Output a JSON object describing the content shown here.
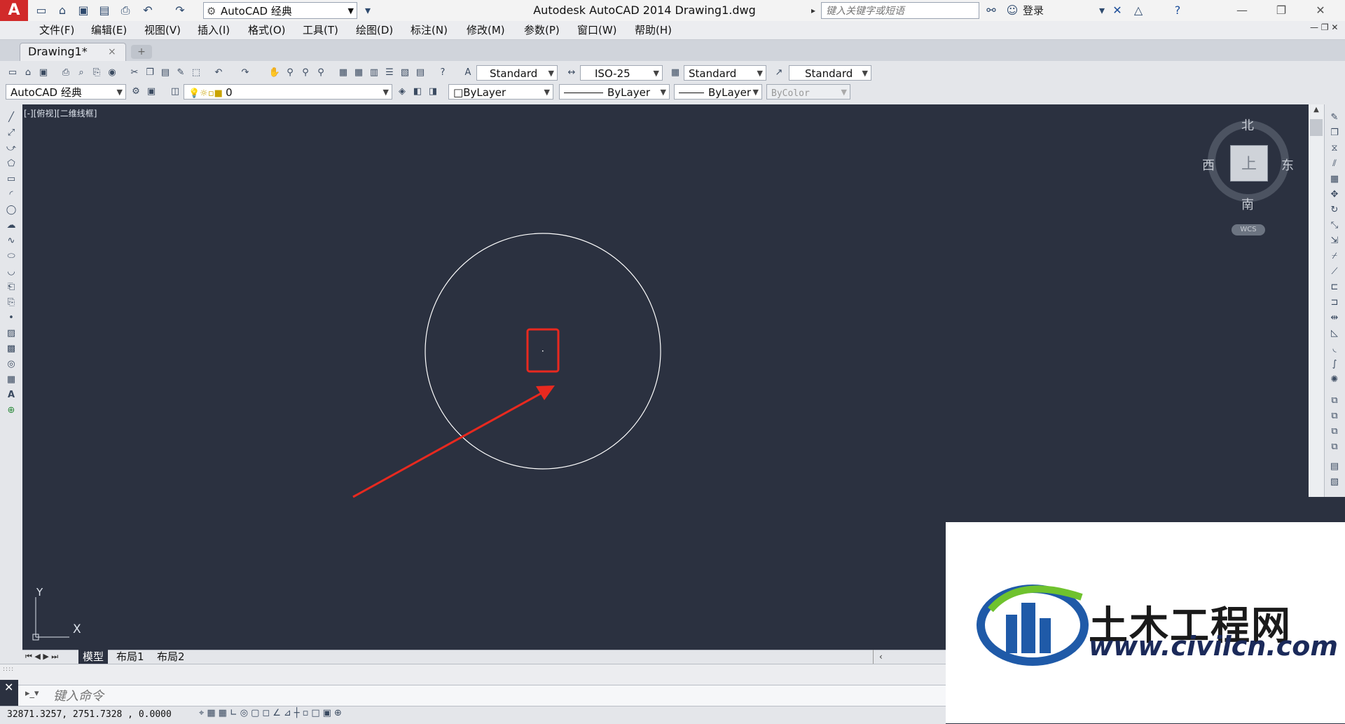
{
  "titlebar": {
    "workspace": "AutoCAD 经典",
    "title": "Autodesk AutoCAD 2014    Drawing1.dwg",
    "search_placeholder": "键入关键字或短语",
    "login": "登录",
    "minimize": "—",
    "restore": "❐",
    "close": "✕"
  },
  "menu": [
    "文件(F)",
    "编辑(E)",
    "视图(V)",
    "插入(I)",
    "格式(O)",
    "工具(T)",
    "绘图(D)",
    "标注(N)",
    "修改(M)",
    "参数(P)",
    "窗口(W)",
    "帮助(H)"
  ],
  "doc_tab": {
    "label": "Drawing1*",
    "close": "×"
  },
  "styles_toolbar": {
    "text_style": "Standard",
    "dim_style": "ISO-25",
    "table_style": "Standard",
    "multileader_style": "Standard"
  },
  "props_toolbar": {
    "workspace": "AutoCAD 经典",
    "layer": "0",
    "color": "ByLayer",
    "linetype": "ByLayer",
    "lineweight": "ByLayer",
    "plotstyle": "ByColor"
  },
  "viewport": {
    "label": "[-][俯视][二维线框]"
  },
  "viewcube": {
    "north": "北",
    "south": "南",
    "east": "东",
    "west": "西",
    "face": "上",
    "wcs": "WCS"
  },
  "ucs": {
    "x": "X",
    "y": "Y"
  },
  "layout_tabs": [
    "模型",
    "布局1",
    "布局2"
  ],
  "command": {
    "placeholder": "键入命令"
  },
  "status": {
    "coords": "32871.3257, 2751.7328 , 0.0000"
  },
  "watermark": {
    "title": "土木工程网",
    "url": "www.civilcn.com"
  },
  "colors": {
    "canvas": "#2b3140",
    "annotation": "#e8291f",
    "entity": "#ffffff"
  }
}
